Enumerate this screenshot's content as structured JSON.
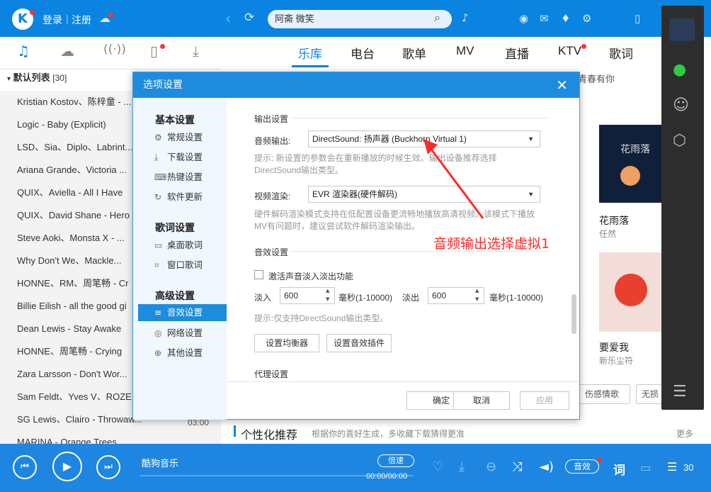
{
  "topbar": {
    "login": "登录",
    "register": "注册",
    "search_value": "阿斋 微笑"
  },
  "tabs": [
    "乐库",
    "电台",
    "歌单",
    "MV",
    "直播",
    "KTV",
    "歌词"
  ],
  "playlist": {
    "title": "默认列表",
    "count": "[30]",
    "songs": [
      "Kristian Kostov、陈梓童 - ...",
      "Logic - Baby (Explicit)",
      "LSD、Sia、Diplo、Labrint...",
      "Ariana Grande、Victoria ...",
      "QUIX、Aviella - All I Have",
      "QUIX、David Shane - Hero",
      "Steve Aoki、Monsta X - ...",
      "Why Don't We、Mackle...",
      "HONNE、RM、周笔畅 - Cr",
      "Billie Eilish - all the good gi",
      "Dean Lewis - Stay Awake",
      "HONNE、周笔畅 - Crying",
      "Zara Larsson - Don't Wor...",
      "Sam Feldt、Yves V、ROZE",
      "SG Lewis、Clairo - Throwaw...",
      "MARINA - Orange Trees"
    ],
    "time_last": "03:00"
  },
  "content": {
    "header_right": "青春有你",
    "card1_title": "花雨落",
    "card1_artist": "任然",
    "card1_cover": "花雨落",
    "card2_title": "要爱我",
    "card2_artist": "新乐尘符",
    "tag1": "伤感情歌",
    "tag2": "无损",
    "rec_title": "个性化推荐",
    "rec_sub": "根据你的喜好生成，多收藏下载猜得更准",
    "more": "更多"
  },
  "dialog": {
    "title": "选项设置",
    "nav": {
      "basic": "基本设置",
      "general": "常规设置",
      "download": "下载设置",
      "hotkey": "热键设置",
      "update": "软件更新",
      "lyrics": "歌词设置",
      "desktop": "桌面歌词",
      "window": "窗口歌词",
      "advanced": "高级设置",
      "sound": "音效设置",
      "network": "网络设置",
      "other": "其他设置"
    },
    "output_title": "输出设置",
    "audio_label": "音频输出:",
    "audio_value": "DirectSound: 扬声器 (Buckhorn Virtual 1)",
    "audio_hint1": "提示: 新设置的参数会在重新播放的时候生效。输出设备推荐选择",
    "audio_hint2": "DirectSound输出类型。",
    "video_label": "视频渲染:",
    "video_value": "EVR 渲染器(硬件解码)",
    "video_hint1": "硬件解码渲染模式支持在低配置设备更流畅地播放高清视频。该模式下播放",
    "video_hint2": "MV有问题时，建议尝试软件解码渲染输出。",
    "effects_title": "音效设置",
    "fade_label": "激活声音淡入淡出功能",
    "fadein_label": "淡入",
    "fadein_value": "600",
    "fadein_unit": "毫秒(1-10000)",
    "fadeout_label": "淡出",
    "fadeout_value": "600",
    "fadeout_unit": "毫秒(1-10000)",
    "fade_hint": "提示:仅支持DirectSound输出类型。",
    "eq_button": "设置均衡器",
    "plugin_button": "设置音效插件",
    "proxy_title": "代理设置",
    "ok": "确定",
    "cancel": "取消",
    "apply": "应用"
  },
  "annotation": "音频输出选择虚拟1",
  "player": {
    "title": "酷狗音乐",
    "speed": "倍速",
    "time": "00:00/00:00",
    "effect": "音效",
    "lyric": "词",
    "count": "30"
  },
  "colors": {
    "accent": "#0a84e0",
    "annotation": "#ff2a2a"
  }
}
